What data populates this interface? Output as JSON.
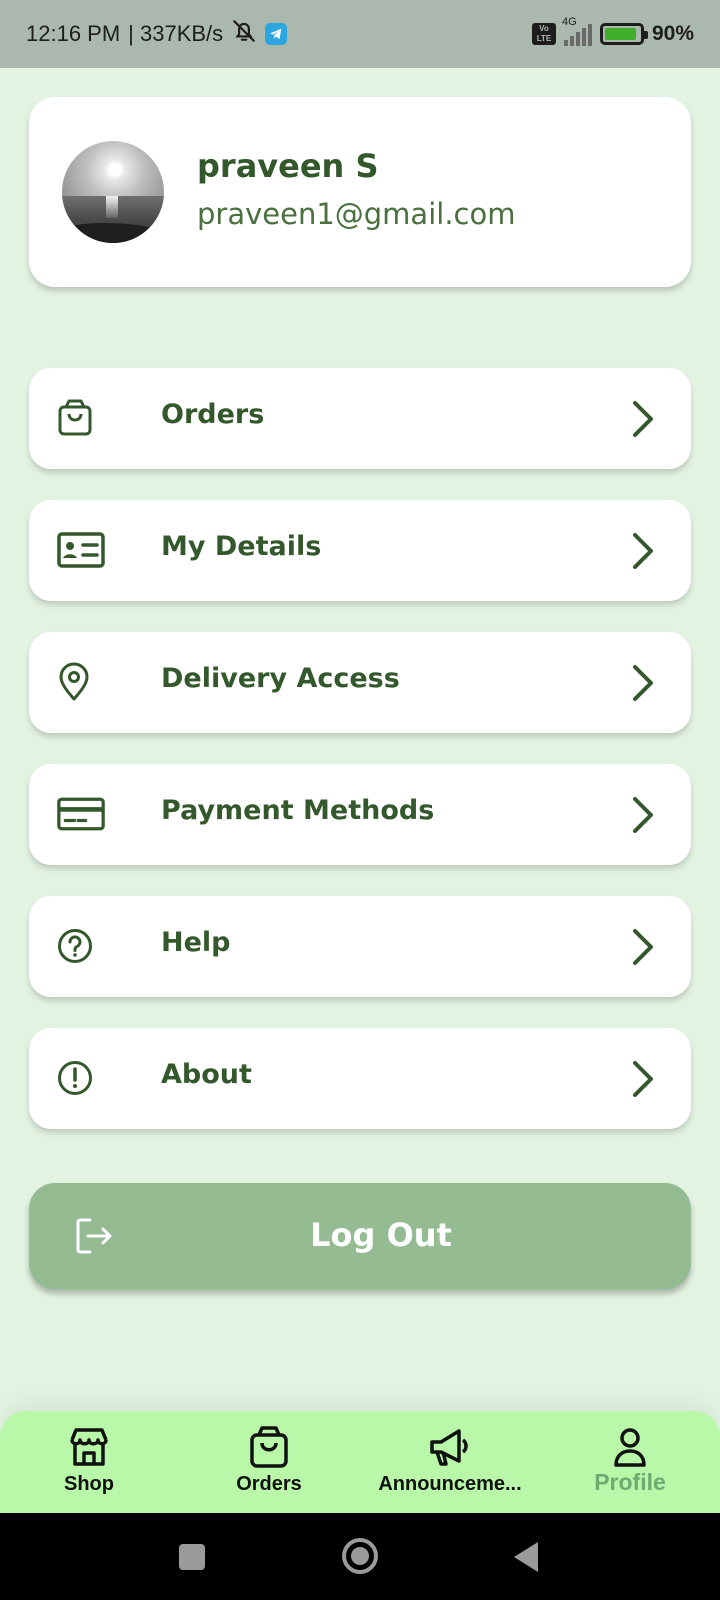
{
  "status_bar": {
    "time": "12:16 PM",
    "speed": "| 337KB/s",
    "network": "4G",
    "volte": "Vo LTE",
    "battery": "90%"
  },
  "profile": {
    "name": "praveen S",
    "email": "praveen1@gmail.com"
  },
  "menu": {
    "items": [
      {
        "label": "Orders",
        "icon": "shopping-bag-icon"
      },
      {
        "label": "My Details",
        "icon": "id-card-icon"
      },
      {
        "label": "Delivery Access",
        "icon": "location-pin-icon"
      },
      {
        "label": "Payment Methods",
        "icon": "credit-card-icon"
      },
      {
        "label": "Help",
        "icon": "question-circle-icon"
      },
      {
        "label": "About",
        "icon": "exclamation-circle-icon"
      }
    ]
  },
  "logout": {
    "label": "Log Out",
    "icon": "logout-icon"
  },
  "bottom_nav": {
    "items": [
      {
        "label": "Shop",
        "icon": "storefront-icon"
      },
      {
        "label": "Orders",
        "icon": "shopping-bag-icon"
      },
      {
        "label": "Announceme...",
        "icon": "megaphone-icon"
      },
      {
        "label": "Profile",
        "icon": "person-icon",
        "active": true
      }
    ]
  },
  "colors": {
    "primary": "#33582b",
    "background": "#e3f3e2",
    "logout": "#94bb91",
    "nav": "#b8f8a8",
    "active_nav": "#6cab71"
  }
}
